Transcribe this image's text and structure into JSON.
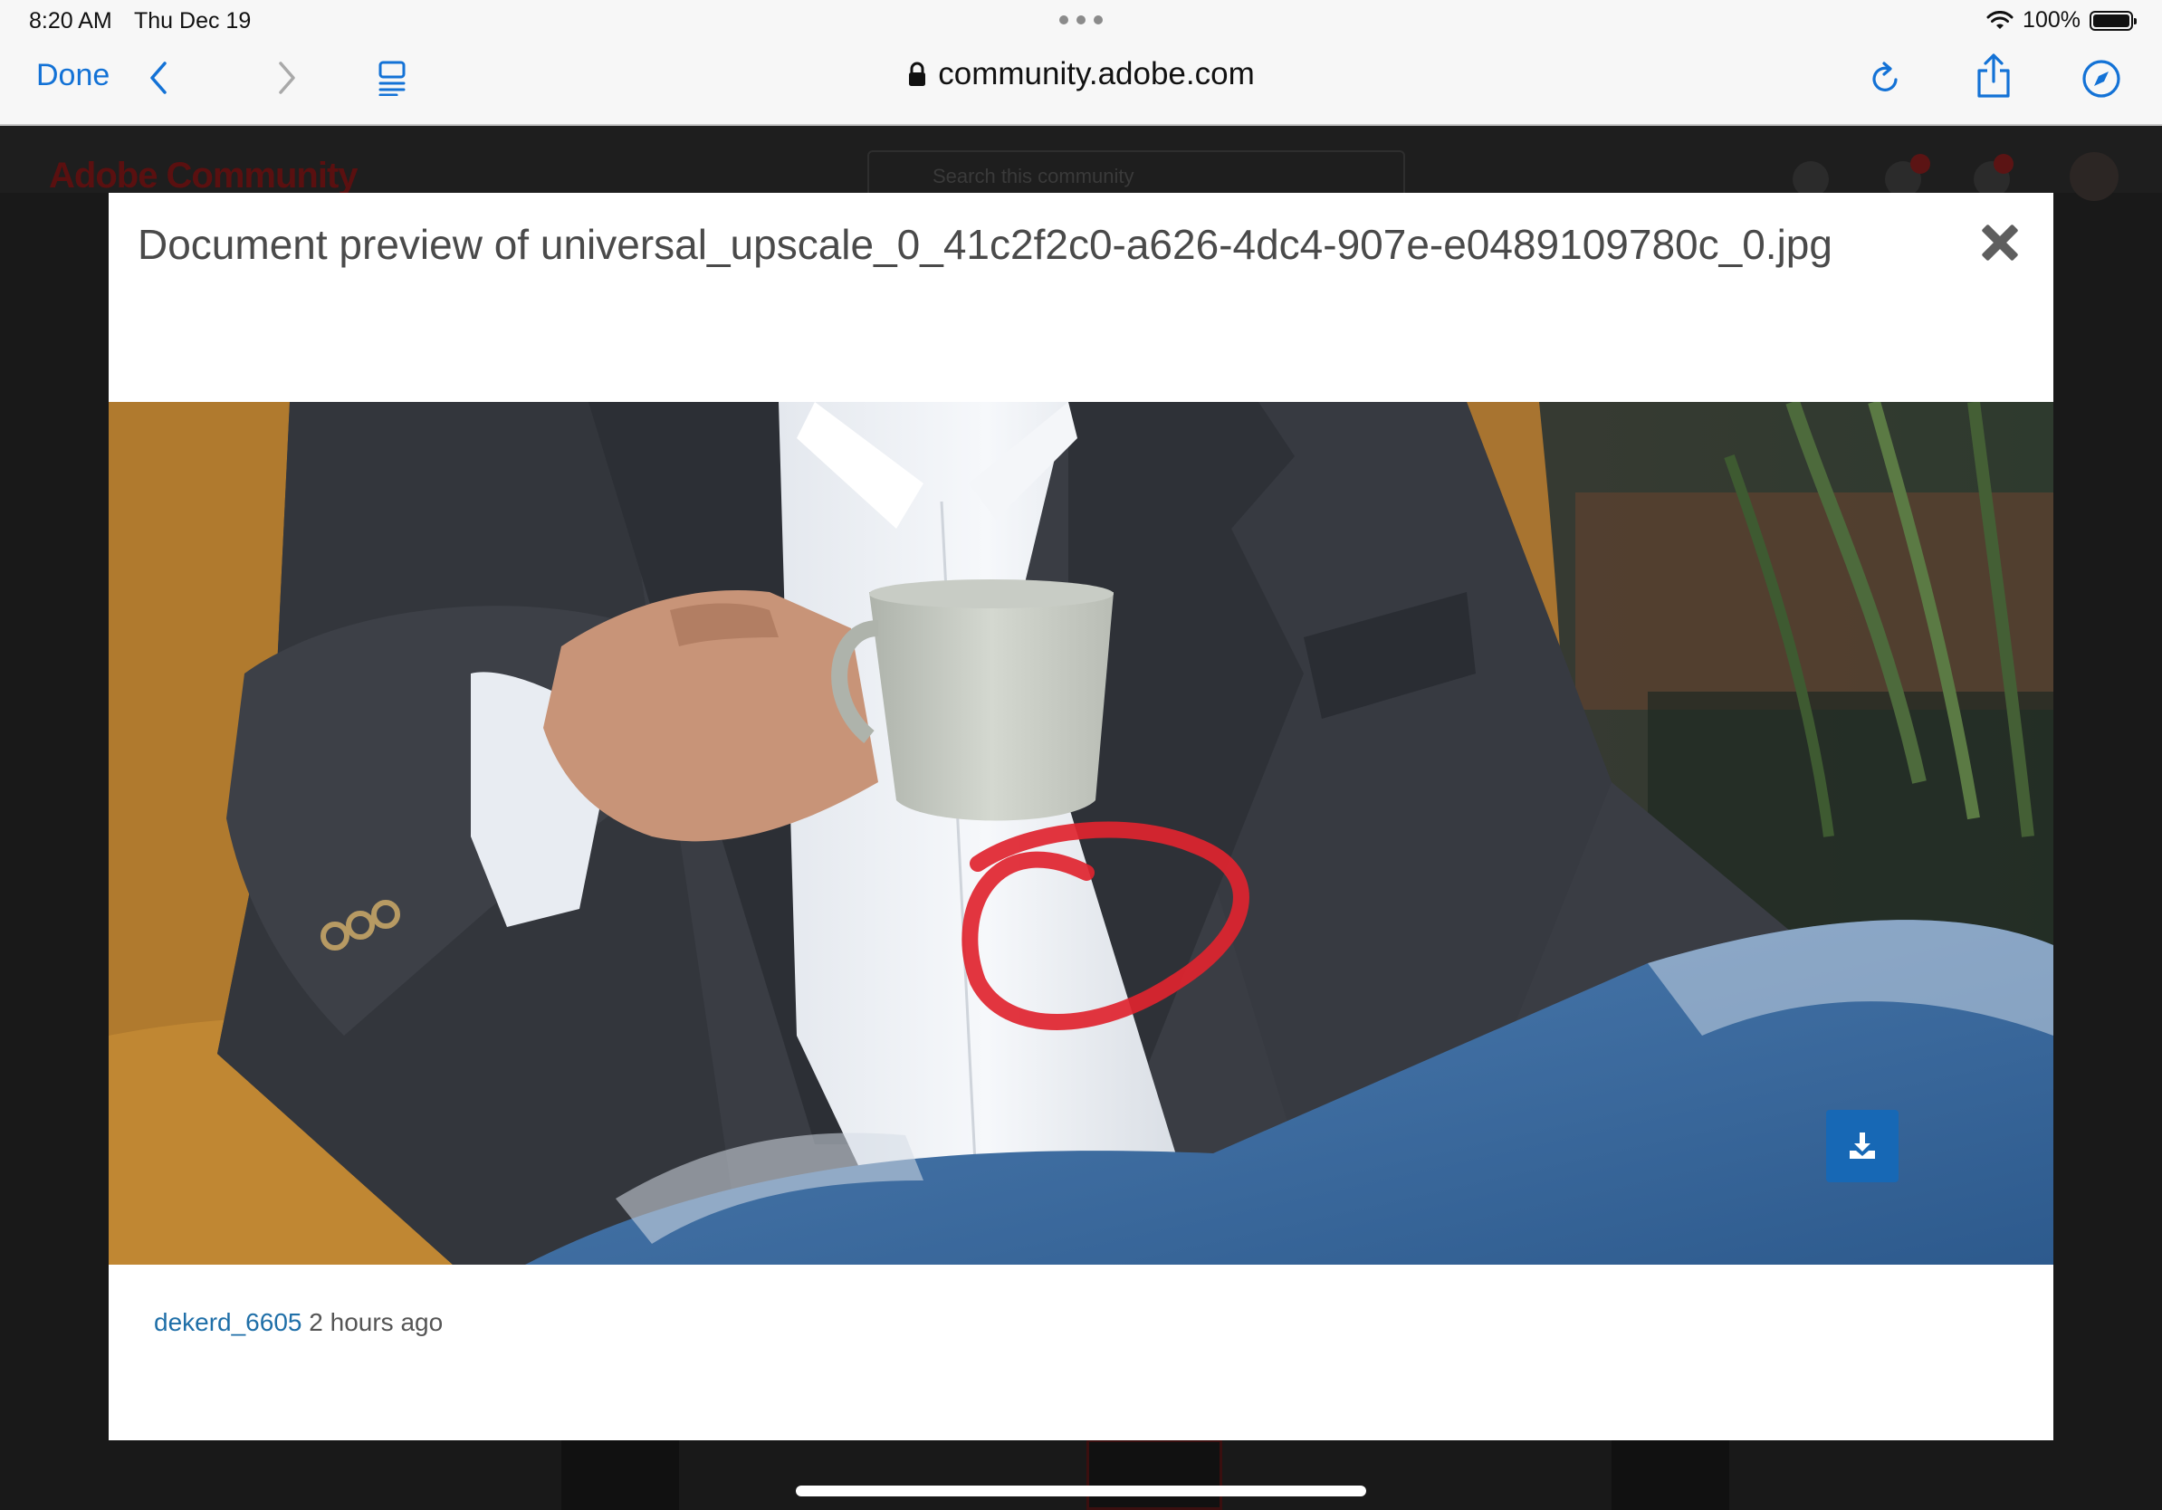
{
  "status_bar": {
    "time": "8:20 AM",
    "date": "Thu Dec 19",
    "battery": "100%"
  },
  "toolbar": {
    "done_label": "Done",
    "url": "community.adobe.com"
  },
  "background_page": {
    "logo": "Adobe Community",
    "search_placeholder": "Search this community"
  },
  "modal": {
    "title": "Document preview of universal_upscale_0_41c2f2c0-a626-4dc4-907e-e0489109780c_0.jpg",
    "author": "dekerd_6605",
    "posted": "2 hours ago"
  },
  "colors": {
    "link_blue": "#1f6fa8",
    "download_button": "#1768b5",
    "ios_blue": "#1372d6",
    "annotation_red": "#e0242f"
  }
}
